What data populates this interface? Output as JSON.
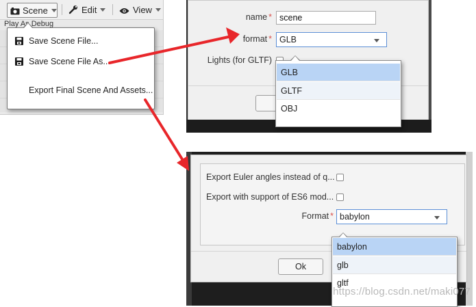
{
  "toolbar": {
    "scene_label": "Scene",
    "edit_label": "Edit",
    "view_label": "View",
    "submenu_text": "Play As Debug"
  },
  "scene_menu": {
    "items": [
      {
        "label": "Save Scene File...",
        "icon": "floppy-disk-icon"
      },
      {
        "label": "Save Scene File As...",
        "icon": "floppy-disk-icon"
      },
      {
        "label": "Export Final Scene And Assets...",
        "icon": ""
      }
    ]
  },
  "export_dialog": {
    "name_label": "name",
    "name_value": "scene",
    "format_label": "format",
    "format_value": "GLB",
    "lights_label": "Lights (for GLTF)",
    "required_mark": "*",
    "format_options": [
      "GLB",
      "GLTF",
      "OBJ"
    ],
    "selected_option": "GLB"
  },
  "final_dialog": {
    "euler_label": "Export Euler angles instead of q...",
    "es6_label": "Export with support of ES6 mod...",
    "format_label": "Format",
    "format_value": "babylon",
    "format_options": [
      "babylon",
      "glb",
      "gltf"
    ],
    "selected_option": "babylon",
    "ok_label": "Ok"
  },
  "watermark": "https://blog.csdn.net/maki077",
  "colors": {
    "arrow": "#e8262a",
    "selected_option_bg": "#b9d4f5",
    "required": "#d9534f",
    "select_border": "#5b8ed6"
  }
}
